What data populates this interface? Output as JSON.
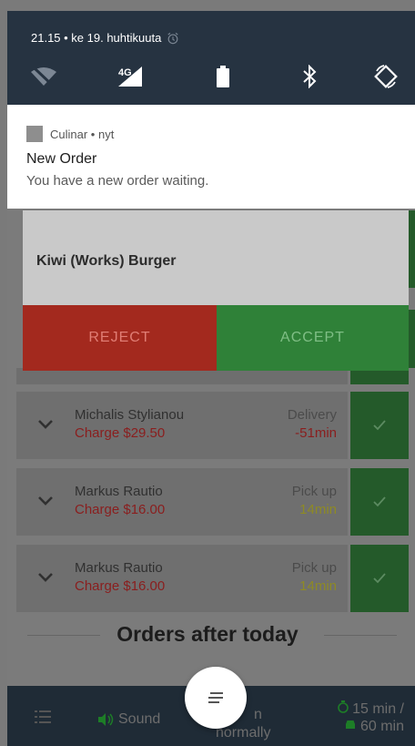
{
  "status_bar": {
    "time_date": "21.15 • ke 19. huhtikuuta",
    "network_label": "4G",
    "icons": [
      "alarm-icon",
      "wifi-off-icon",
      "signal-icon",
      "battery-icon",
      "bluetooth-icon",
      "auto-rotate-icon"
    ]
  },
  "notification": {
    "app_line": "Culinar • nyt",
    "title": "New Order",
    "text": "You have a new order waiting."
  },
  "popup": {
    "item_name": "Kiwi (Works) Burger",
    "reject_label": "REJECT",
    "accept_label": "ACCEPT"
  },
  "orders": [
    {
      "name": "Michalis Stylianou",
      "charge": "Charge $29.50",
      "type": "Delivery",
      "time": "-51min",
      "time_color": "#8a1e1e"
    },
    {
      "name": "Markus Rautio",
      "charge": "Charge $16.00",
      "type": "Pick up",
      "time": "14min",
      "time_color": "#8e8a24"
    },
    {
      "name": "Markus Rautio",
      "charge": "Charge $16.00",
      "type": "Pick up",
      "time": "14min",
      "time_color": "#8e8a24"
    }
  ],
  "section_title": "Orders after today",
  "bottom_bar": {
    "sound_label": "Sound",
    "mode_line1": "n",
    "mode_line2": "normally",
    "prep_time": "15 min /",
    "delivery_time": "60 min"
  },
  "colors": {
    "accent_green": "#2f8138",
    "reject_red": "#a3291e",
    "shade_bg": "#263341"
  }
}
